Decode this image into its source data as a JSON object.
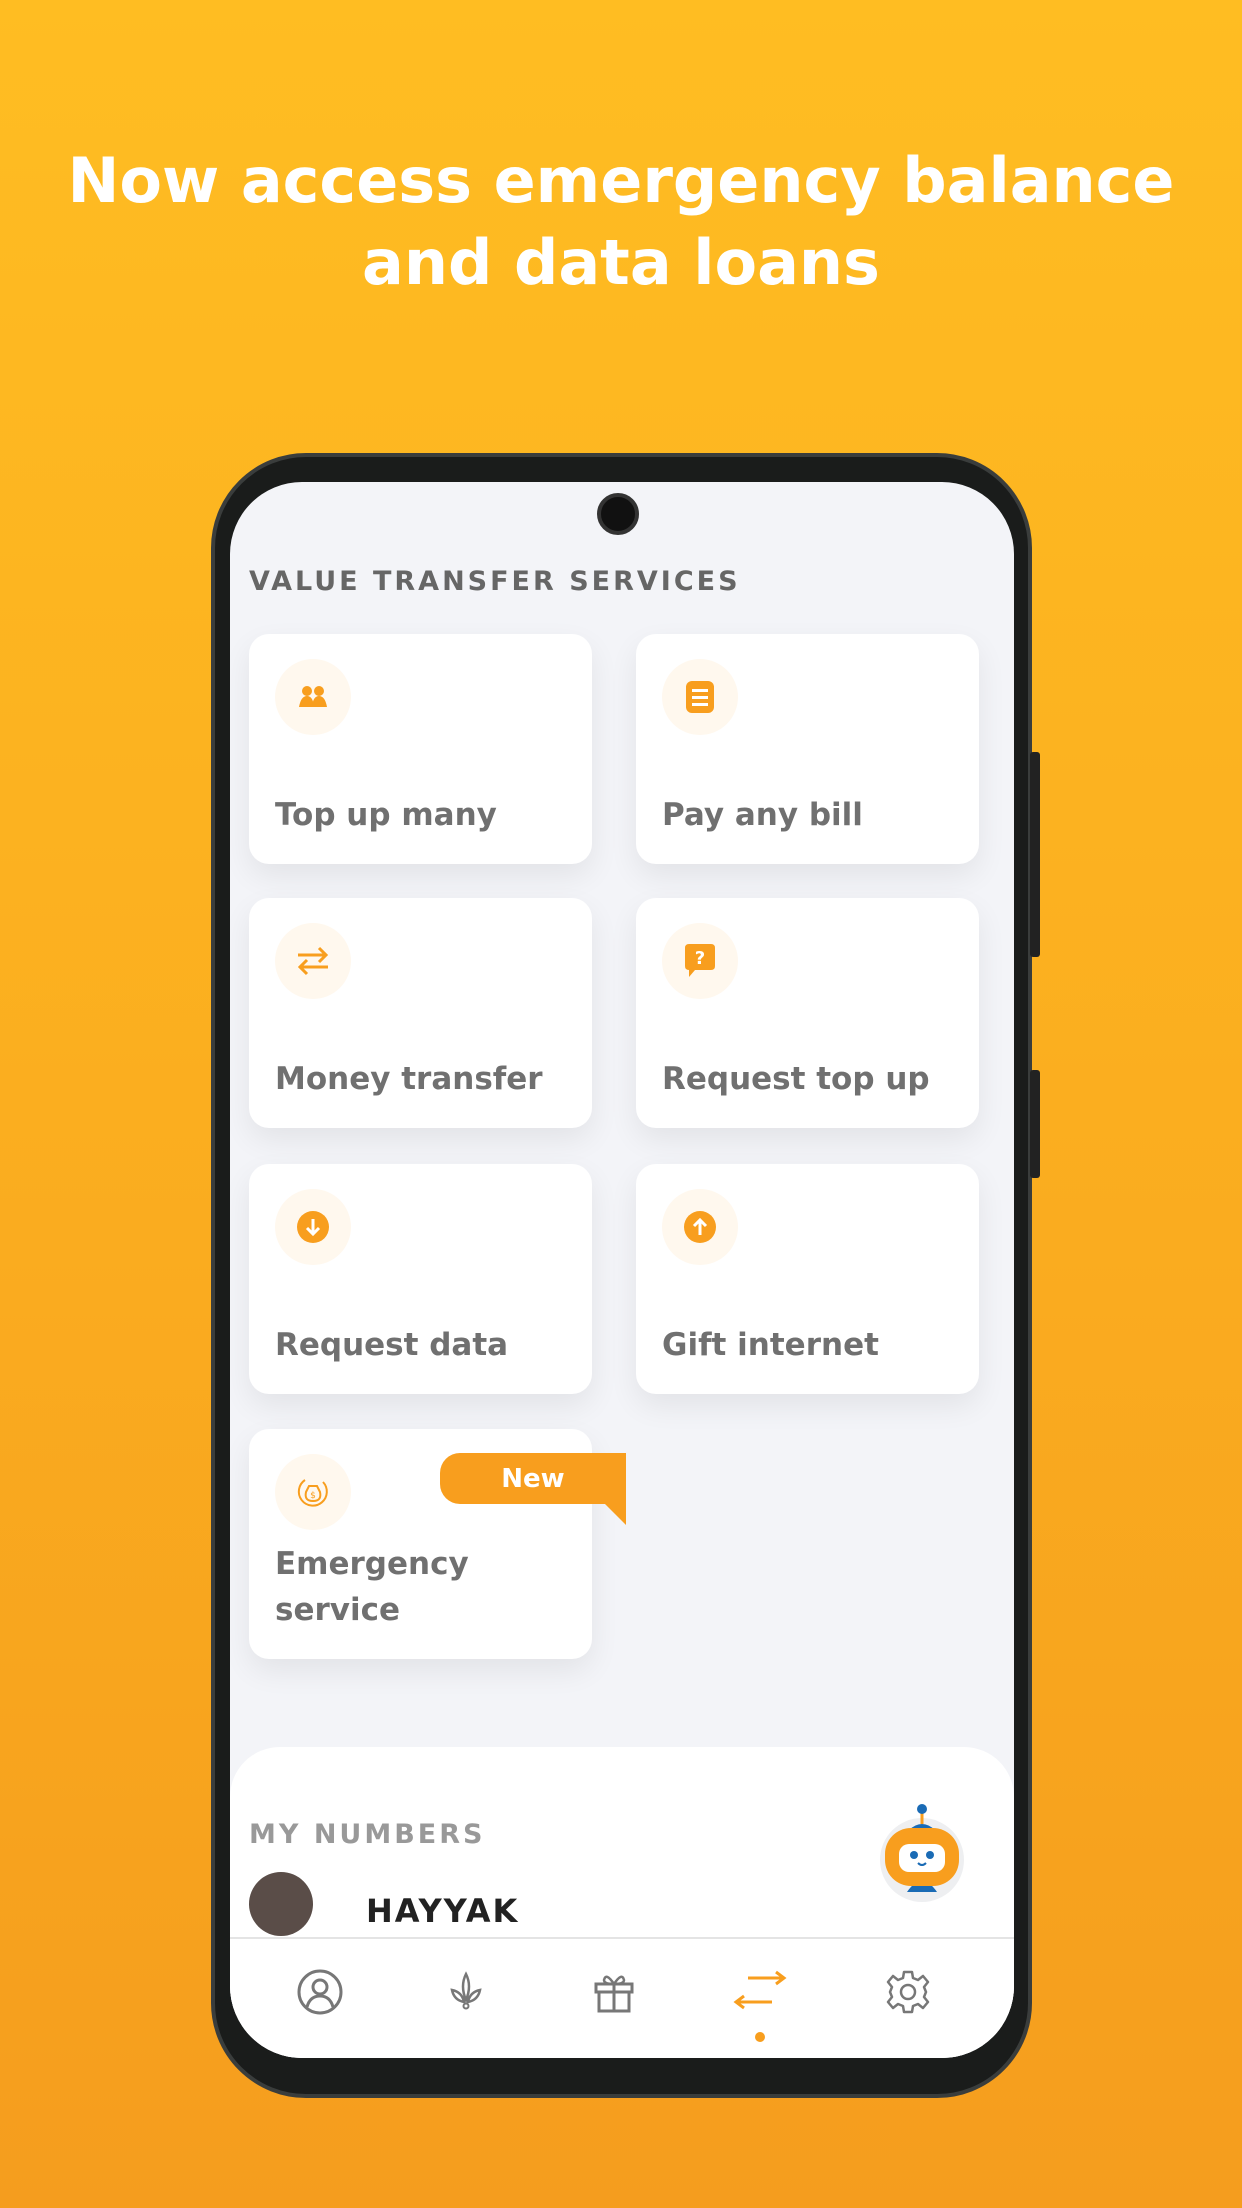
{
  "headline": {
    "line1": "Now access emergency  balance",
    "line2": "and data loans"
  },
  "colors": {
    "accent": "#F89E1E",
    "background_top": "#FFBD22",
    "background_bottom": "#F59D1E"
  },
  "section_title": "VALUE TRANSFER SERVICES",
  "services": [
    {
      "label": "Top up many",
      "icon": "people-icon"
    },
    {
      "label": "Pay any bill",
      "icon": "bill-icon"
    },
    {
      "label": "Money transfer",
      "icon": "transfer-arrows-icon"
    },
    {
      "label": "Request top up",
      "icon": "question-bubble-icon"
    },
    {
      "label": "Request data",
      "icon": "arrow-down-circle-icon"
    },
    {
      "label": "Gift internet",
      "icon": "arrow-up-circle-icon"
    },
    {
      "label": "Emergency service",
      "icon": "money-bag-icon",
      "badge": "New"
    }
  ],
  "my_numbers": {
    "title": "MY NUMBERS",
    "first_name": "HAYYAK"
  },
  "nav": {
    "items": [
      "profile-icon",
      "lotus-icon",
      "gift-icon",
      "transfer-icon",
      "settings-icon"
    ],
    "active_index": 3
  }
}
